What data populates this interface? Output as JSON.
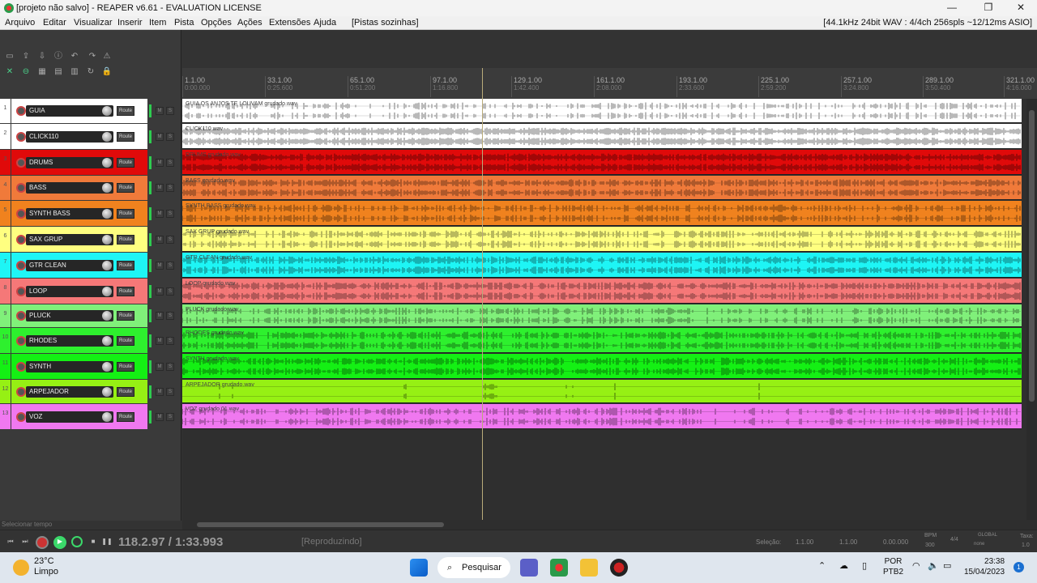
{
  "window": {
    "title": "[projeto não salvo] - REAPER v6.61 - EVALUATION LICENSE",
    "minimize": "—",
    "maximize": "❐",
    "close": "✕"
  },
  "menubar": {
    "items": [
      "Arquivo",
      "Editar",
      "Visualizar",
      "Inserir",
      "Item",
      "Pista",
      "Opções",
      "Ações",
      "Extensões",
      "Ajuda",
      "[Pistas sozinhas]"
    ],
    "status": "[44.1kHz 24bit WAV : 4/4ch 256spls ~12/12ms ASIO]"
  },
  "ruler": {
    "marks": [
      {
        "bar": "1.1.00",
        "time": "0:00.000"
      },
      {
        "bar": "33.1.00",
        "time": "0:25.600"
      },
      {
        "bar": "65.1.00",
        "time": "0:51.200"
      },
      {
        "bar": "97.1.00",
        "time": "1:16.800"
      },
      {
        "bar": "129.1.00",
        "time": "1:42.400"
      },
      {
        "bar": "161.1.00",
        "time": "2:08.000"
      },
      {
        "bar": "193.1.00",
        "time": "2:33.600"
      },
      {
        "bar": "225.1.00",
        "time": "2:59.200"
      },
      {
        "bar": "257.1.00",
        "time": "3:24.800"
      },
      {
        "bar": "289.1.00",
        "time": "3:50.400"
      },
      {
        "bar": "321.1.00",
        "time": "4:16.000"
      }
    ]
  },
  "tracks": [
    {
      "num": "1",
      "name": "GUIA",
      "item": "GUIA OS ANJOS TE LOUVAM grudado.wav",
      "color": "#ffffff",
      "panel": "#ffffff",
      "dense": 0.45
    },
    {
      "num": "2",
      "name": "CLICK110",
      "item": "CLICK110.wav",
      "color": "#ffffff",
      "panel": "#ffffff",
      "dense": 1.0
    },
    {
      "num": "3",
      "name": "DRUMS",
      "item": "DRUMS grudado.wav",
      "color": "#e00a0a",
      "panel": "#e00a0a",
      "dense": 0.95
    },
    {
      "num": "4",
      "name": "BASS",
      "item": "BASS grudado.wav",
      "color": "#f07a3a",
      "panel": "#f07a3a",
      "dense": 0.85
    },
    {
      "num": "5",
      "name": "SYNTH BASS",
      "item": "SYNTH BASS grudado.wav",
      "color": "#f0821e",
      "panel": "#f0821e",
      "dense": 0.55
    },
    {
      "num": "6",
      "name": "SAX GRUP",
      "item": "SAX GRUP grudado.wav",
      "color": "#ffff80",
      "panel": "#ffff80",
      "dense": 0.6
    },
    {
      "num": "7",
      "name": "GTR CLEAN",
      "item": "GTR CLEAN grudado.wav",
      "color": "#1ef5f5",
      "panel": "#1ef5f5",
      "dense": 0.8
    },
    {
      "num": "8",
      "name": "LOOP",
      "item": "LOOP grudado.wav",
      "color": "#f57878",
      "panel": "#f57878",
      "dense": 0.75
    },
    {
      "num": "9",
      "name": "PLUCK",
      "item": "PLUCK grudado.wav",
      "color": "#80f07a",
      "panel": "#80f07a",
      "dense": 0.5
    },
    {
      "num": "10",
      "name": "RHODES",
      "item": "RHODES grudado.wav",
      "color": "#2ef02e",
      "panel": "#2ef02e",
      "dense": 0.7
    },
    {
      "num": "11",
      "name": "SYNTH",
      "item": "SYNTH grudado.wav",
      "color": "#14f014",
      "panel": "#14f014",
      "dense": 0.75
    },
    {
      "num": "12",
      "name": "ARPEJADOR",
      "item": "ARPEJADOR grudado.wav",
      "color": "#96f014",
      "panel": "#96f014",
      "dense": 0.02
    },
    {
      "num": "13",
      "name": "VOZ",
      "item": "VOZ grudado 01.wav",
      "color": "#f078f0",
      "panel": "#f078f0",
      "dense": 0.55
    }
  ],
  "labels": {
    "route": "Route",
    "mute": "M",
    "solo": "S"
  },
  "status_hint": "Selecionar tempo",
  "transport": {
    "position": "118.2.97 / 1:33.993",
    "state": "[Reproduzindo]",
    "selection_label": "Seleção:",
    "sel_start": "1.1.00",
    "sel_end": "1.1.00",
    "sel_len": "0.00.000",
    "bpm_label": "BPM",
    "bpm": "300",
    "timesig": "4/4",
    "global_label": "GLOBAL",
    "global_value": "none",
    "rate_label": "Taxa:",
    "rate": "1.0"
  },
  "taskbar": {
    "temp": "23°C",
    "weather": "Limpo",
    "search": "Pesquisar",
    "lang1": "POR",
    "lang2": "PTB2",
    "time": "23:38",
    "date": "15/04/2023",
    "notif": "1"
  }
}
